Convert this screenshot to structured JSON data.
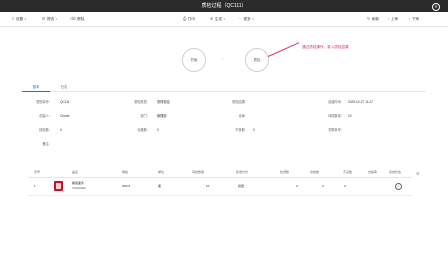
{
  "window": {
    "title": "质检过程（QC111）"
  },
  "toolbar": {
    "left": [
      {
        "icon": "list-icon",
        "label": "设置"
      },
      {
        "icon": "filter-icon",
        "label": "筛选"
      },
      {
        "icon": "trash-icon",
        "label": "删除"
      }
    ],
    "center": [
      {
        "icon": "print-icon",
        "label": "打印"
      },
      {
        "icon": "generate-icon",
        "label": "生成"
      },
      {
        "icon": "more-icon",
        "label": "更多"
      }
    ],
    "right": [
      {
        "icon": "refresh-icon",
        "label": "刷新"
      },
      {
        "icon": "prev-icon",
        "label": "上审"
      },
      {
        "icon": "next-icon",
        "label": "下审"
      }
    ]
  },
  "steps": [
    {
      "label": "开始"
    },
    {
      "label": "质检"
    }
  ],
  "annotation": {
    "text": "通过质检操作，录入质检结果",
    "color": "#d6246e"
  },
  "tabs": [
    {
      "label": "基本"
    },
    {
      "label": "日志"
    }
  ],
  "form": {
    "row1": [
      {
        "label": "质检单号：",
        "value": "QC111"
      },
      {
        "label": "质检类型：",
        "value": "常规检验"
      },
      {
        "label": "质检结果：",
        "value": ""
      },
      {
        "label": "创建时间：",
        "value": "2025-02-27 11:27"
      }
    ],
    "row2": [
      {
        "label": "创建人：",
        "value": "Chmet"
      },
      {
        "label": "部门：",
        "value": "管理部"
      },
      {
        "label": "仓库：",
        "value": ""
      },
      {
        "label": "待检数量：",
        "value": "10"
      }
    ],
    "row3": [
      {
        "label": "检验数：",
        "value": "0"
      },
      {
        "label": "合格数：",
        "value": "0"
      },
      {
        "label": "不良数：",
        "value": "0"
      },
      {
        "label": "关联单号：",
        "value": ""
      }
    ],
    "row4": [
      {
        "label": "备注：",
        "value": ""
      }
    ]
  },
  "table": {
    "headers": [
      "序号",
      "品名",
      "规格",
      "单位",
      "待检数量",
      "检测方式",
      "检测数",
      "合格数",
      "不良数",
      "合格率",
      "完成状态"
    ],
    "rows": [
      {
        "index": "1",
        "name": "螺旋面条",
        "code": "C0100002",
        "spec": "300ml",
        "unit": "瓶",
        "qty": "10",
        "method": "批量",
        "tested": "0",
        "passed": "0",
        "bad": "0",
        "rate": ""
      }
    ]
  }
}
